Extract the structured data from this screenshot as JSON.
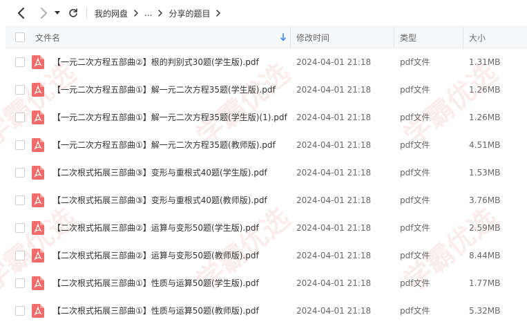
{
  "breadcrumb": {
    "root": "我的网盘",
    "ellipsis": "...",
    "current": "分享的题目"
  },
  "columns": {
    "name": "文件名",
    "time": "修改时间",
    "type": "类型",
    "size": "大小"
  },
  "files": [
    {
      "name": "【一元二次方程五部曲②】根的判别式30题(学生版).pdf",
      "time": "2024-04-01 21:18",
      "type": "pdf文件",
      "size": "1.31MB"
    },
    {
      "name": "【一元二次方程五部曲①】解一元二次方程35题(学生版).pdf",
      "time": "2024-04-01 21:18",
      "type": "pdf文件",
      "size": "1.26MB"
    },
    {
      "name": "【一元二次方程五部曲①】解一元二次方程35题(学生版)(1).pdf",
      "time": "2024-04-01 21:18",
      "type": "pdf文件",
      "size": "1.26MB"
    },
    {
      "name": "【一元二次方程五部曲①】解一元二次方程35题(教师版).pdf",
      "time": "2024-04-01 21:18",
      "type": "pdf文件",
      "size": "4.51MB"
    },
    {
      "name": "【二次根式拓展三部曲③】变形与重根式40题(学生版).pdf",
      "time": "2024-04-01 21:18",
      "type": "pdf文件",
      "size": "1.53MB"
    },
    {
      "name": "【二次根式拓展三部曲③】变形与重根式40题(教师版).pdf",
      "time": "2024-04-01 21:18",
      "type": "pdf文件",
      "size": "3.76MB"
    },
    {
      "name": "【二次根式拓展三部曲②】运算与变形50题(学生版).pdf",
      "time": "2024-04-01 21:18",
      "type": "pdf文件",
      "size": "2.59MB"
    },
    {
      "name": "【二次根式拓展三部曲②】运算与变形50题(教师版).pdf",
      "time": "2024-04-01 21:18",
      "type": "pdf文件",
      "size": "8.44MB"
    },
    {
      "name": "【二次根式拓展三部曲①】性质与运算50题(学生版).pdf",
      "time": "2024-04-01 21:18",
      "type": "pdf文件",
      "size": "1.77MB"
    },
    {
      "name": "【二次根式拓展三部曲①】性质与运算50题(教师版).pdf",
      "time": "2024-04-01 21:18",
      "type": "pdf文件",
      "size": "5.32MB"
    }
  ],
  "watermark": "学霸优选",
  "colors": {
    "pdf_icon": "#f26b6b",
    "header_bg": "#f7f8fa",
    "sort_arrow": "#3b8cf5"
  },
  "icons": {
    "back": "chevron-left-icon",
    "forward": "chevron-right-icon",
    "dropdown": "caret-down-icon",
    "refresh": "refresh-icon",
    "sort": "sort-down-icon",
    "file": "pdf-file-icon"
  }
}
